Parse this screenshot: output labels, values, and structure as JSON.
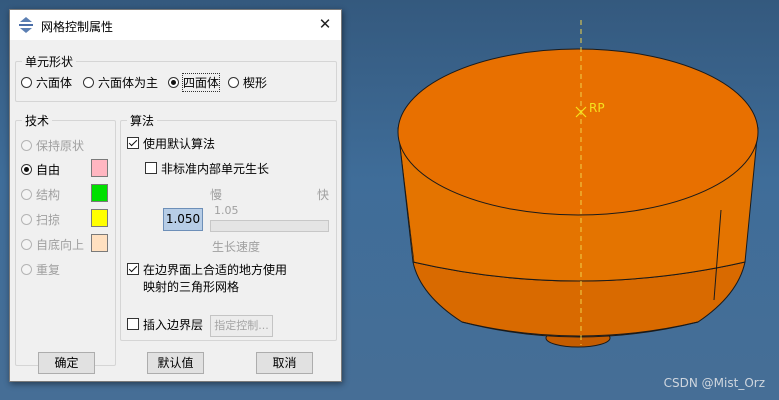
{
  "dialog": {
    "title": "网格控制属性",
    "element_shape": {
      "legend": "单元形状",
      "options": [
        "六面体",
        "六面体为主",
        "四面体",
        "楔形"
      ],
      "selected": "四面体"
    },
    "technique": {
      "legend": "技术",
      "options": [
        "保持原状",
        "自由",
        "结构",
        "扫掠",
        "自底向上",
        "重复"
      ],
      "selected": "自由",
      "colors": [
        "#ffb6c1",
        "#00e000",
        "#ffff00",
        "#ffe0c0"
      ]
    },
    "algorithm": {
      "legend": "算法",
      "use_default": "使用默认算法",
      "use_default_checked": true,
      "nonstandard_growth": "非标准内部单元生长",
      "nonstandard_growth_checked": false,
      "slow_label": "慢",
      "fast_label": "快",
      "growth_value": "1.050",
      "growth_value_display": "1.05",
      "growth_rate_label": "生长速度",
      "boundary_line1": "在边界面上合适的地方使用",
      "boundary_line2": "映射的三角形网格",
      "boundary_checked": true,
      "insert_boundary": "插入边界层",
      "insert_boundary_checked": false,
      "specify_controls": "指定控制..."
    },
    "buttons": {
      "ok": "确定",
      "defaults": "默认值",
      "cancel": "取消"
    }
  },
  "viewport": {
    "reference_point_label": "RP",
    "part_color": "#e87000",
    "background_top": "#34597e",
    "background_bottom": "#466e96"
  },
  "watermark": "CSDN @Mist_Orz"
}
